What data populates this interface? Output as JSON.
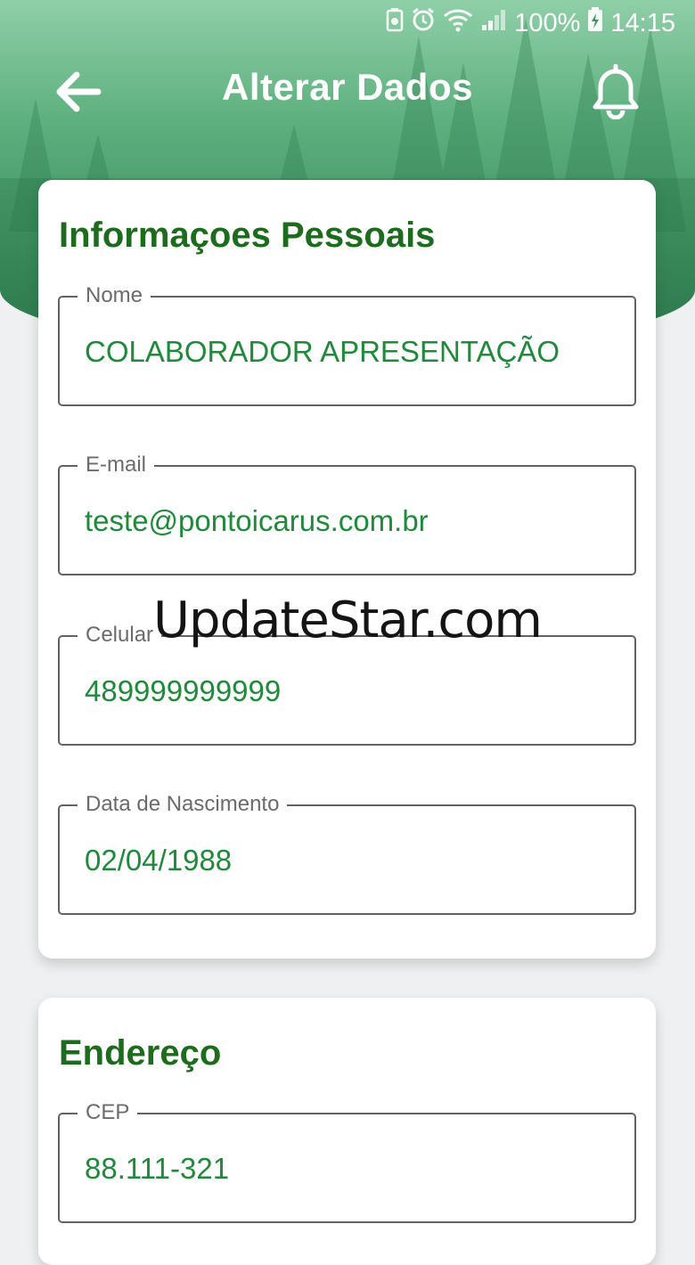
{
  "status_bar": {
    "battery_percent": "100%",
    "time": "14:15",
    "icons": [
      "battery-saver-icon",
      "alarm-icon",
      "wifi-icon",
      "signal-icon",
      "battery-charging-icon"
    ]
  },
  "toolbar": {
    "title": "Alterar Dados",
    "back_icon": "arrow-left-icon",
    "notification_icon": "bell-icon"
  },
  "personal_info": {
    "title": "Informaçoes Pessoais",
    "fields": [
      {
        "label": "Nome",
        "value": "COLABORADOR APRESENTAÇÃO"
      },
      {
        "label": "E-mail",
        "value": "teste@pontoicarus.com.br"
      },
      {
        "label": "Celular",
        "value": "489999999999"
      },
      {
        "label": "Data de Nascimento",
        "value": "02/04/1988"
      }
    ]
  },
  "address": {
    "title": "Endereço",
    "fields": [
      {
        "label": "CEP",
        "value": "88.111-321"
      }
    ]
  },
  "watermark": "UpdateStar.com",
  "colors": {
    "header_green": "#4f9f70",
    "title_green": "#1d6b1d",
    "value_green": "#1f8a3a",
    "background": "#eef0f1"
  }
}
